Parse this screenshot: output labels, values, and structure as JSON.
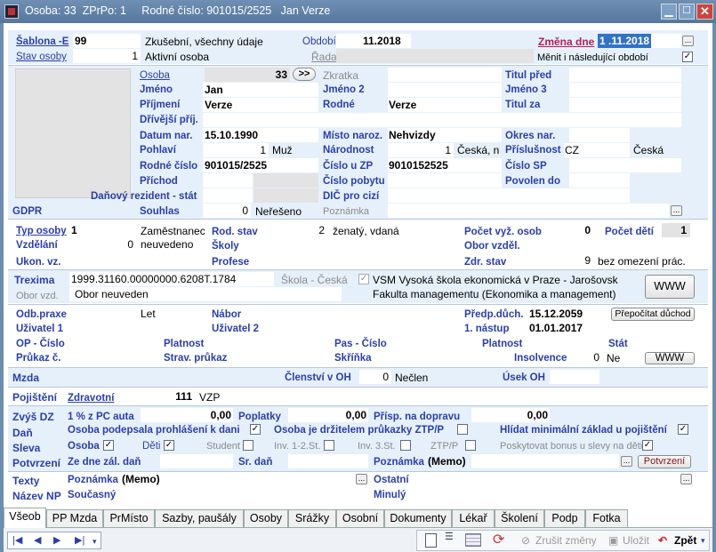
{
  "window": {
    "title": "Osoba: 33  ZPrPo: 1     Rodné číslo: 901015/2525   Jan Verze"
  },
  "header": {
    "sablona_label": "Šablona -E",
    "sablona_value": "99",
    "sablona_desc": "Zkušební, všechny údaje",
    "obdobi_label": "Období",
    "obdobi_value": "11.2018",
    "zmena_label": "Změna dne",
    "zmena_value": "1 .11.2018",
    "stav_label": "Stav osoby",
    "stav_value": "1",
    "stav_desc": "Aktivní osoba",
    "rada_label": "Řada",
    "menit_label": "Měnit i následující období",
    "menit_check": "✓"
  },
  "person": {
    "osoba_label": "Osoba",
    "osoba_value": "33",
    "next_btn": ">>",
    "zkratka_label": "Zkratka",
    "titul_pred_label": "Titul před",
    "jmeno_label": "Jméno",
    "jmeno_value": "Jan",
    "jmeno2_label": "Jméno 2",
    "jmeno3_label": "Jméno 3",
    "prijmeni_label": "Příjmení",
    "prijmeni_value": "Verze",
    "rodne_label": "Rodné",
    "rodne_value": "Verze",
    "titul_za_label": "Titul za",
    "drivejsi_label": "Dřívější příj.",
    "datum_label": "Datum nar.",
    "datum_value": "15.10.1990",
    "misto_label": "Místo naroz.",
    "misto_value": "Nehvizdy",
    "okres_label": "Okres nar.",
    "pohlavi_label": "Pohlaví",
    "pohlavi_code": "1",
    "pohlavi_value": "Muž",
    "narodnost_label": "Národnost",
    "narodnost_code": "1",
    "narodnost_value": "Česká, n",
    "prislusnost_label": "Příslušnost",
    "prislusnost_code": "CZ",
    "prislusnost_value": "Česká",
    "rc_label": "Rodné číslo",
    "rc_value": "901015/2525",
    "cislo_zp_label": "Číslo u ZP",
    "cislo_zp_value": "9010152525",
    "cislo_sp_label": "Číslo SP",
    "prichod_label": "Příchod",
    "cislo_pobytu_label": "Číslo pobytu",
    "povolen_label": "Povolen do",
    "danovy_label": "Daňový rezident - stát",
    "dic_label": "DIČ pro cizí",
    "gdpr_label": "GDPR",
    "souhlas_label": "Souhlas",
    "souhlas_code": "0",
    "souhlas_value": "Neřešeno",
    "poznamka_label": "Poznámka"
  },
  "work": {
    "typ_label": "Typ osoby",
    "typ_code": "1",
    "typ_value": "Zaměstnanec",
    "rod_stav_label": "Rod. stav",
    "rod_stav_code": "2",
    "rod_stav_value": "ženatý, vdaná",
    "pocet_vyz_label": "Počet vyž. osob",
    "pocet_vyz_value": "0",
    "pocet_deti_label": "Počet dětí",
    "pocet_deti_value": "1",
    "vzdelani_label": "Vzdělání",
    "vzdelani_code": "0",
    "vzdelani_value": "neuvedeno",
    "skoly_label": "Školy",
    "obor_label": "Obor vzděl.",
    "ukon_label": "Ukon. vz.",
    "profese_label": "Profese",
    "zdr_label": "Zdr. stav",
    "zdr_code": "9",
    "zdr_value": "bez omezení prác."
  },
  "treximа": {},
  "trexima": {
    "label": "Trexima",
    "value": "1999.31160.00000000.6208T.1784",
    "skola_label": "Škola - Česká",
    "skola_value1": "VSM Vysoká škola ekonomická v Praze - Jarošovsk",
    "skola_value2": "Fakulta managementu (Ekonomika a management)",
    "obor_label": "Obor vzd.",
    "obor_value": "Obor neuveden",
    "www": "WWW"
  },
  "misc": {
    "odb_label": "Odb.praxe",
    "odb_value": "Let",
    "nabor_label": "Nábor",
    "predp_label": "Předp.důch.",
    "predp_value": "15.12.2059",
    "prepocitat": "Přepočítat důchod",
    "uzivatel1_label": "Uživatel 1",
    "uzivatel2_label": "Uživatel 2",
    "nastup_label": "1. nástup",
    "nastup_value": "01.01.2017",
    "op_label": "OP - Číslo",
    "platnost_label": "Platnost",
    "pas_label": "Pas - Číslo",
    "platnost2_label": "Platnost",
    "stat_label": "Stát",
    "prukaz_label": "Průkaz č.",
    "strav_label": "Strav. průkaz",
    "skrinka_label": "Skříňka",
    "insolvence_label": "Insolvence",
    "insolvence_code": "0",
    "insolvence_value": "Ne",
    "www": "WWW"
  },
  "mzda": {
    "label": "Mzda",
    "clenstvi_label": "Členství v OH",
    "clenstvi_code": "0",
    "clenstvi_value": "Nečlen",
    "usek_label": "Úsek OH"
  },
  "pojisteni": {
    "label": "Pojištění",
    "zdravotni_label": "Zdravotní",
    "zdravotni_code": "111",
    "zdravotni_value": "VZP"
  },
  "dz": {
    "zvys_label": "Zvýš DZ",
    "pc_label": "1 % z PC auta",
    "pc_value": "0,00",
    "poplatky_label": "Poplatky",
    "poplatky_value": "0,00",
    "prisp_label": "Přísp. na dopravu",
    "prisp_value": "0,00",
    "dan_label": "Daň",
    "podepsala_label": "Osoba podepsala prohlášení k dani",
    "ztp_label": "Osoba je držitelem průkazky ZTP/P",
    "hlidat_label": "Hlídat minimální základ u pojištění",
    "sleva_label": "Sleva",
    "osoba_label": "Osoba",
    "deti_label": "Děti",
    "student_label": "Student",
    "inv12_label": "Inv. 1-2.St.",
    "inv3_label": "Inv. 3.St.",
    "ztpp_label": "ZTP/P",
    "poskytovat_label": "Poskytovat bonus u slevy na děti",
    "potvrzeni_label": "Potvrzení",
    "ze_dne_label": "Ze dne zál. daň",
    "sr_dan_label": "Sr. daň",
    "poznamka_label": "Poznámka",
    "poznamka_value": "(Memo)",
    "potvrzeni_btn": "Potvrzení",
    "check": "✓"
  },
  "texty": {
    "texty_label": "Texty",
    "nazev_label": "Název NP",
    "poznamka_label": "Poznámka",
    "poznamka_value": "(Memo)",
    "ostatni_label": "Ostatní",
    "soucasny_label": "Současný",
    "minuly_label": "Minulý"
  },
  "tabs": [
    "Všeob",
    "PP Mzda",
    "PrMísto",
    "Sazby, paušály",
    "Osoby",
    "Srážky",
    "Osobní",
    "Dokumenty",
    "Lékař",
    "Školení",
    "Podp",
    "Fotka"
  ],
  "toolbar": {
    "zrusit": "Zrušit změny",
    "ulozit": "Uložit",
    "zpet": "Zpět"
  }
}
